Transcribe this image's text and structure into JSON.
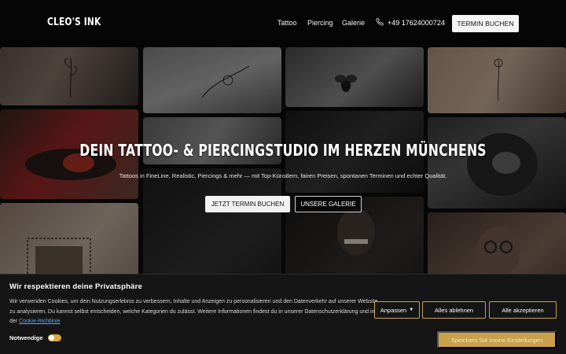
{
  "header": {
    "logo": "CLEO'S INK",
    "nav": [
      "Tattoo",
      "Piercing",
      "Galerie"
    ],
    "phone": "+49 17624000724",
    "phone_icon": "phone-icon",
    "cta": "TERMIN BUCHEN"
  },
  "hero": {
    "title": "DEIN TATTOO- & PIERCINGSTUDIO IM HERZEN MÜNCHENS",
    "subtitle": "Tattoos in FineLine, Realistic, Piercings & mehr — mit Top-Künstlern, fairen Preisen, spontanen Terminen und echter Qualität.",
    "primary_button": "JETZT TERMIN BUCHEN",
    "secondary_button": "UNSERE GALERIE"
  },
  "cookie": {
    "title": "Wir respektieren deine Privatsphäre",
    "text": "Wir verwenden Cookies, um dein Nutzungserlebnis zu verbessern, Inhalte und Anzeigen zu personalisieren und den Datenverkehr auf unserer Website zu analysieren. Du kannst selbst entscheiden, welche Kategorien du zulässt. Weitere Informationen findest du in unserer Datenschutzerklärung und in der ",
    "link": "Cookie-Richtlinie",
    "customize": "Anpassen",
    "reject": "Alles ablehnen",
    "accept": "Alle akzeptieren",
    "necessary_label": "Notwendige",
    "necessary_on": true,
    "save": "Speichern Sie meine Einstellungen"
  },
  "colors": {
    "accent": "#c9a14a",
    "link": "#5aa9f0",
    "background": "#0b0b0b"
  }
}
